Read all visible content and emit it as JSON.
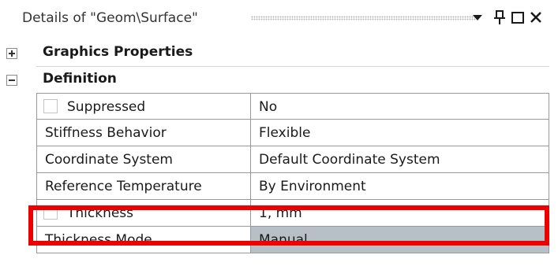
{
  "panel": {
    "title": "Details of \"Geom\\Surface\""
  },
  "sections": {
    "graphics": {
      "label": "Graphics Properties",
      "expanded": false
    },
    "definition": {
      "label": "Definition",
      "expanded": true
    }
  },
  "rows": [
    {
      "name": "Suppressed",
      "value": "No",
      "checkbox": true
    },
    {
      "name": "Stiffness Behavior",
      "value": "Flexible",
      "checkbox": false
    },
    {
      "name": "Coordinate System",
      "value": "Default Coordinate System",
      "checkbox": false
    },
    {
      "name": "Reference Temperature",
      "value": "By Environment",
      "checkbox": false
    },
    {
      "name": "Thickness",
      "value": "1, mm",
      "checkbox": true
    },
    {
      "name": "Thickness Mode",
      "value": "Manual",
      "checkbox": false,
      "value_bg": "#b7c0c7"
    }
  ],
  "icons": {
    "dropdown": "dropdown-arrow-icon",
    "pin": "pin-icon",
    "maximize": "maximize-icon",
    "close": "close-icon"
  },
  "colors": {
    "highlight": "#ee0000",
    "readonly_value_bg": "#b7c0c7"
  }
}
